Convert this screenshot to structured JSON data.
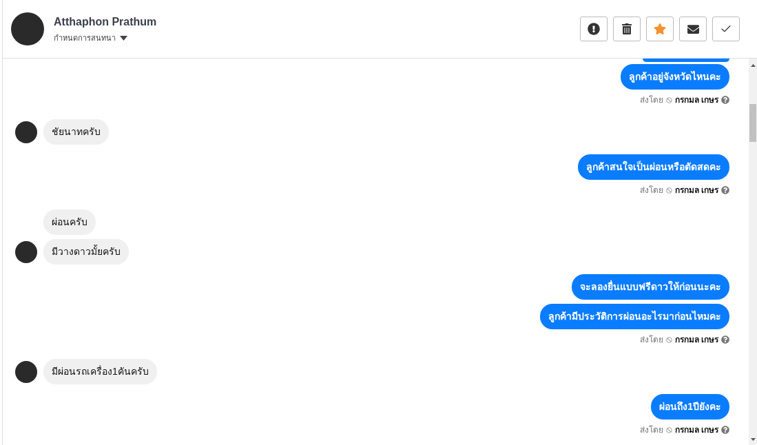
{
  "header": {
    "name": "Atthaphon Prathum",
    "assign_label": "กำหนดการสนทนา",
    "actions": [
      {
        "kind": "alert"
      },
      {
        "kind": "delete"
      },
      {
        "kind": "star",
        "on": true
      },
      {
        "kind": "mail"
      },
      {
        "kind": "done"
      }
    ]
  },
  "messages": [
    {
      "kind": "outgoing",
      "bubbles": [
        "ลูกค้าอยู่จังหวัดไหนคะ"
      ],
      "sent_by": {
        "label": "ส่งโดย",
        "agent": "กรกมล เกษร"
      }
    },
    {
      "kind": "incoming",
      "bubbles": [
        "ชัยนาทครับ"
      ]
    },
    {
      "kind": "outgoing",
      "bubbles": [
        "ลูกค้าสนใจเป็นผ่อนหรือตัดสดคะ"
      ],
      "sent_by": {
        "label": "ส่งโดย",
        "agent": "กรกมล เกษร"
      }
    },
    {
      "kind": "incoming",
      "bubbles": [
        "ผ่อนครับ",
        "มีวางดาวมั้ยครับ"
      ]
    },
    {
      "kind": "outgoing",
      "bubbles": [
        "จะลองยื่นแบบฟรีดาวให้ก่อนนะคะ",
        "ลูกค้ามีประวัติการผ่อนอะไรมาก่อนไหมคะ"
      ],
      "sent_by": {
        "label": "ส่งโดย",
        "agent": "กรกมล เกษร"
      }
    },
    {
      "kind": "incoming",
      "bubbles": [
        "มีผ่อนรถเครื่อง1คันครับ"
      ]
    },
    {
      "kind": "outgoing",
      "bubbles": [
        "ผ่อนถึง1ปียังคะ"
      ],
      "sent_by": {
        "label": "ส่งโดย",
        "agent": "กรกมล เกษร"
      }
    }
  ]
}
